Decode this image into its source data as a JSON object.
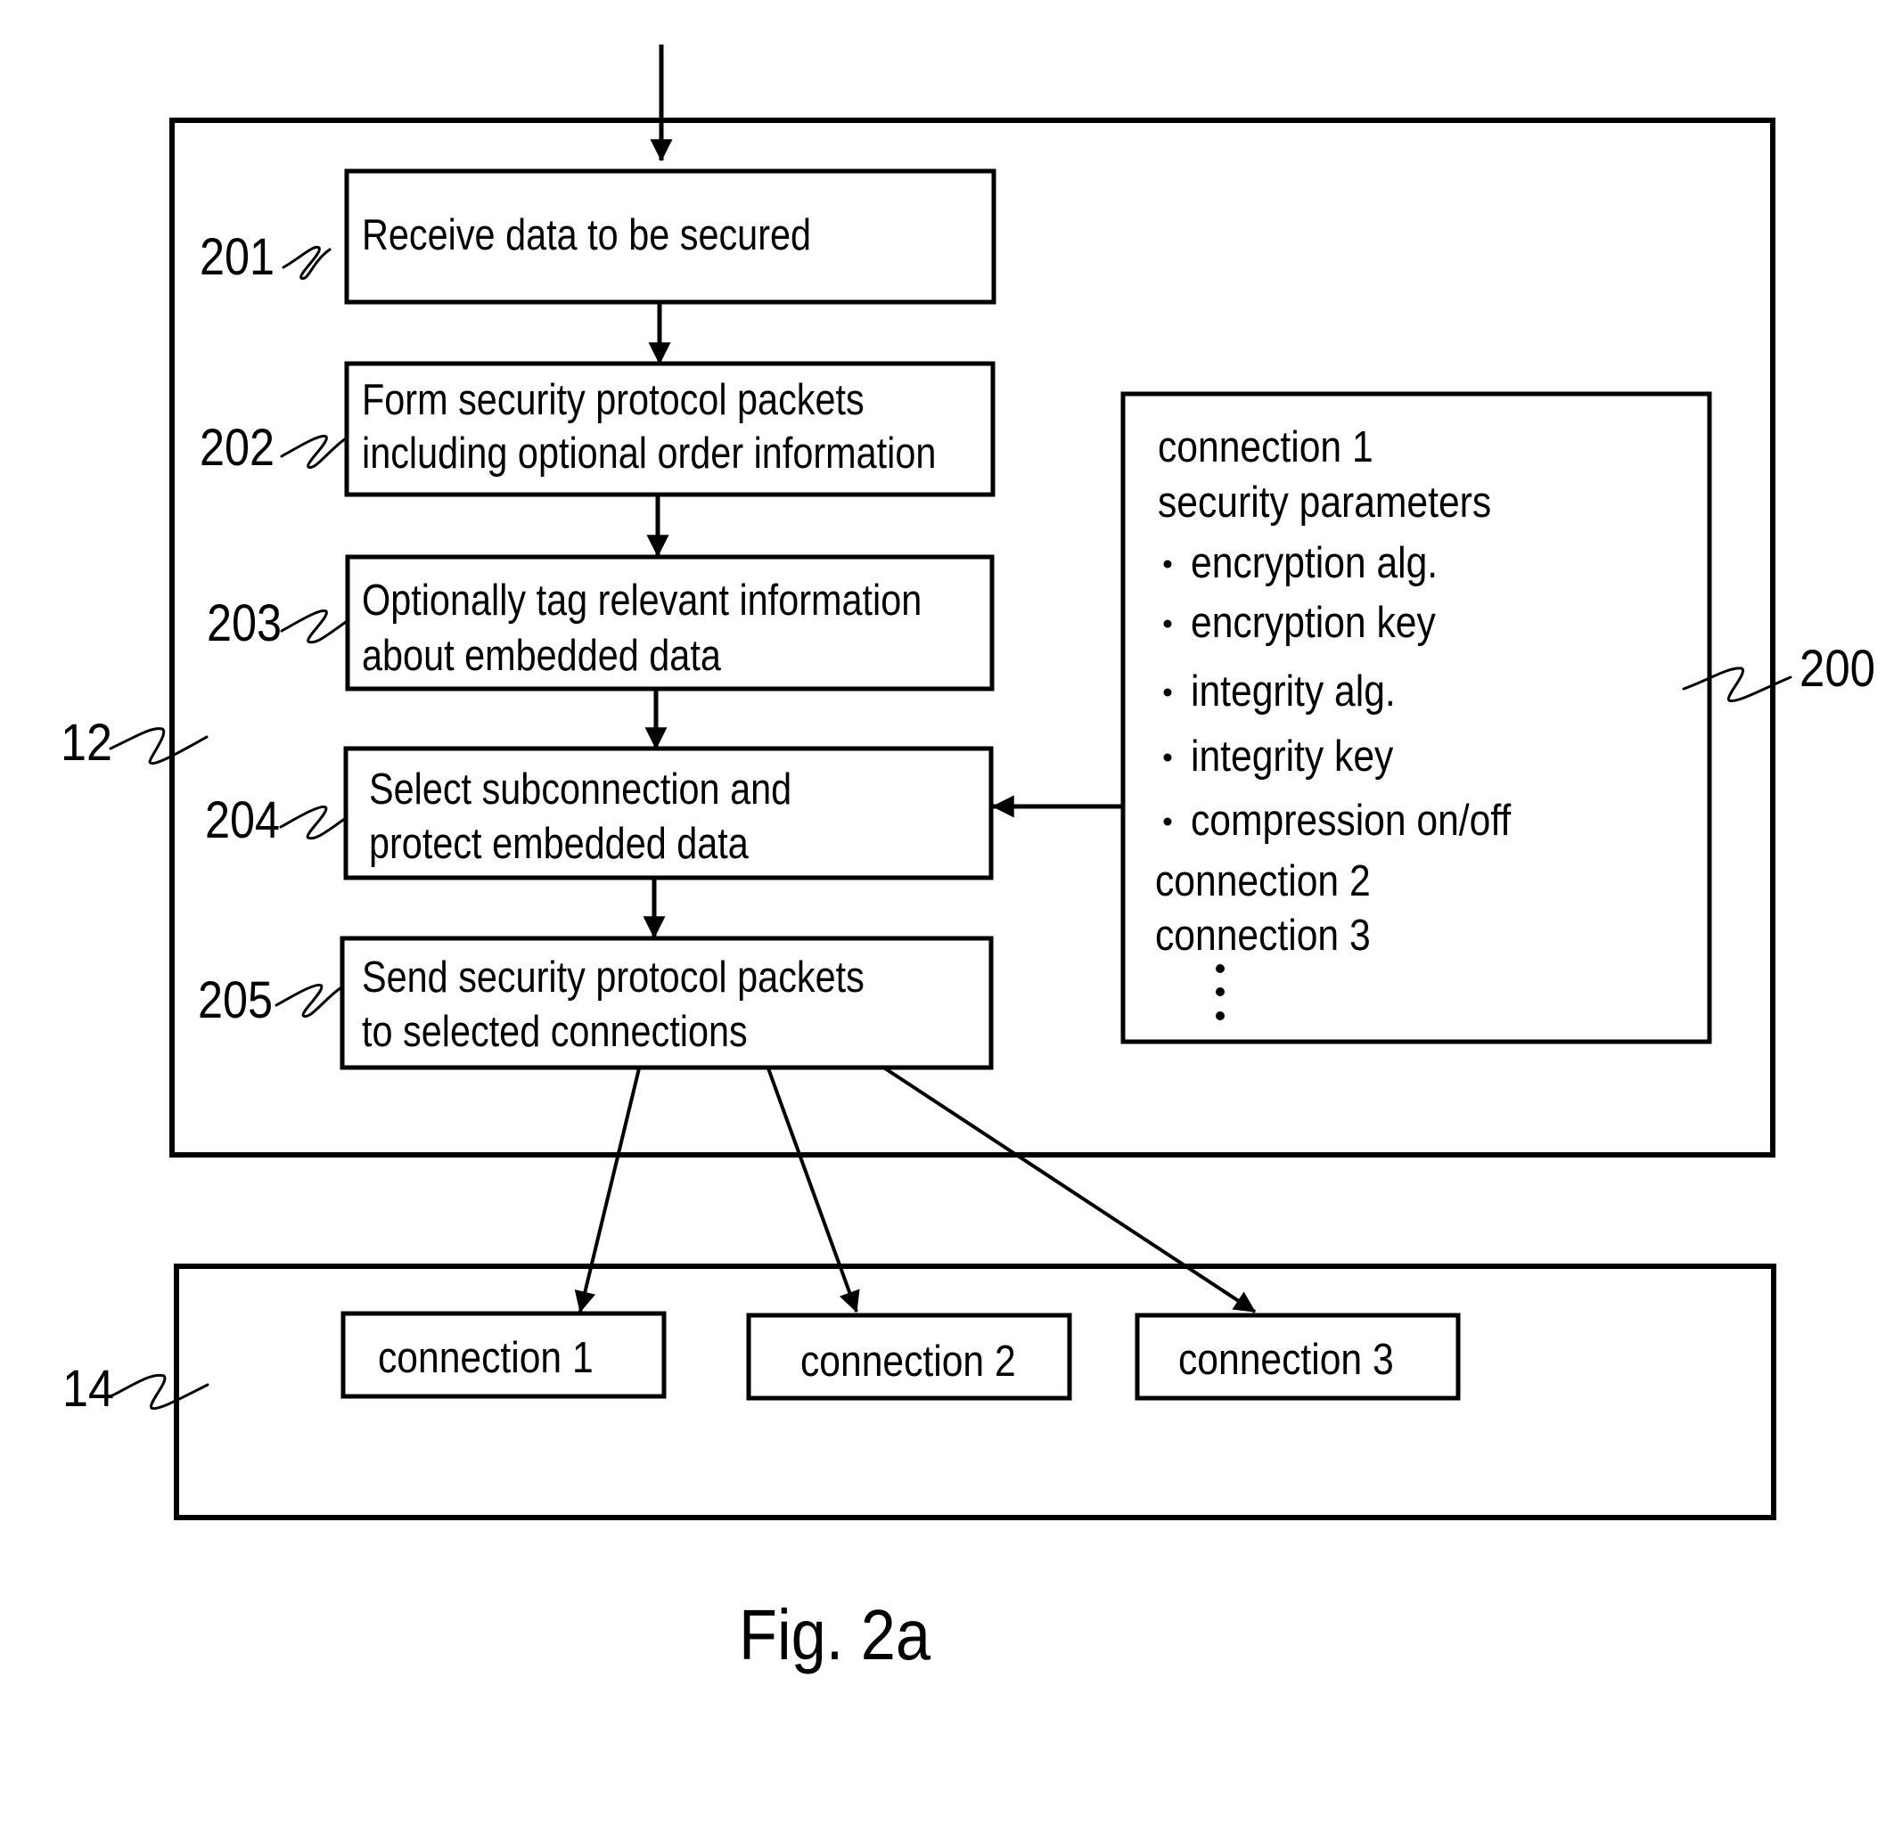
{
  "figure": {
    "caption": "Fig. 2a",
    "device_label": "12",
    "network_label": "14",
    "parameter_store_label": "200"
  },
  "steps": [
    {
      "ref": "201",
      "lines": [
        "Receive data to be secured"
      ]
    },
    {
      "ref": "202",
      "lines": [
        "Form security protocol packets",
        "including optional order information"
      ]
    },
    {
      "ref": "203",
      "lines": [
        "Optionally tag relevant information",
        "about embedded data"
      ]
    },
    {
      "ref": "204",
      "lines": [
        "Select subconnection and",
        "protect embedded data"
      ]
    },
    {
      "ref": "205",
      "lines": [
        "Send security protocol packets",
        "to selected connections"
      ]
    }
  ],
  "parameters": {
    "header": [
      "connection 1",
      "security parameters"
    ],
    "bullets": [
      "encryption alg.",
      "encryption key",
      "integrity alg.",
      "integrity key",
      "compression on/off"
    ],
    "others": [
      "connection 2",
      "connection 3"
    ],
    "bullet_glyph": "•",
    "continuation": "vertical-ellipsis"
  },
  "connections": [
    {
      "label": "connection 1"
    },
    {
      "label": "connection 2"
    },
    {
      "label": "connection 3"
    }
  ]
}
